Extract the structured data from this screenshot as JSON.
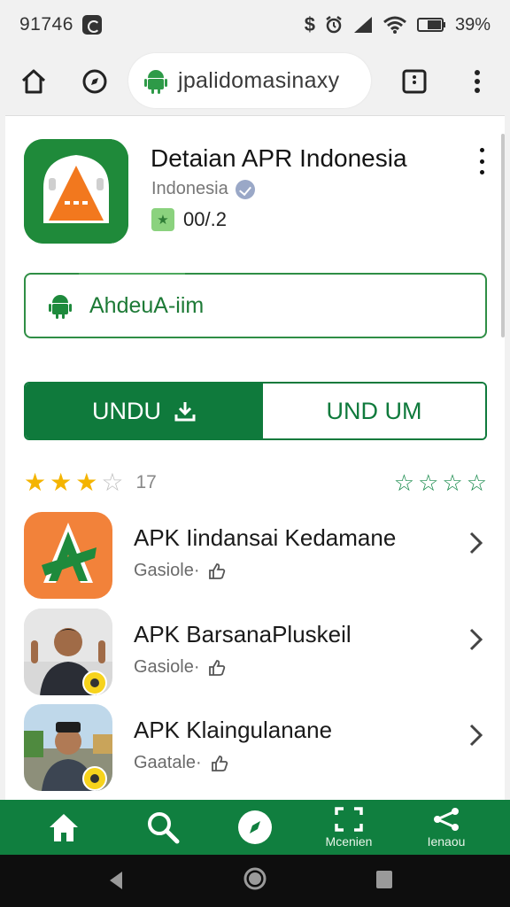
{
  "status_bar": {
    "time": "91746",
    "battery": "39%"
  },
  "browser": {
    "url": "jpalidomasinaxy",
    "icons": [
      "home-icon",
      "compass-icon",
      "android-icon",
      "tab-switcher-icon",
      "more-vert-icon"
    ]
  },
  "app": {
    "title": "Detaian APR Indonesia",
    "subtitle": "Indonesia",
    "rating_text": "00/.2",
    "package_label": "AhdeuA-iim",
    "tabs": {
      "primary_label": "UNDU",
      "secondary_label": "UND UM"
    },
    "review_count": "17",
    "stars_filled": 3,
    "stars_total": 4
  },
  "list": {
    "items": [
      {
        "title": "APK Iindansai Kedamane",
        "subtitle": "Gasiole·"
      },
      {
        "title": "APK BarsanaPluskeil",
        "subtitle": "Gasiole·"
      },
      {
        "title": "APK Klaingulanane",
        "subtitle": "Gaatale·"
      }
    ]
  },
  "bottom_nav": {
    "items": [
      {
        "icon": "home-icon",
        "label": ""
      },
      {
        "icon": "search-icon",
        "label": ""
      },
      {
        "icon": "explore-icon",
        "label": ""
      },
      {
        "icon": "scan-icon",
        "label": "Mcenien"
      },
      {
        "icon": "share-icon",
        "label": "Ienaou"
      }
    ]
  },
  "colors": {
    "brand_green": "#0f7a3c",
    "star_yellow": "#f4b400",
    "thumb_orange": "#f2823a"
  }
}
